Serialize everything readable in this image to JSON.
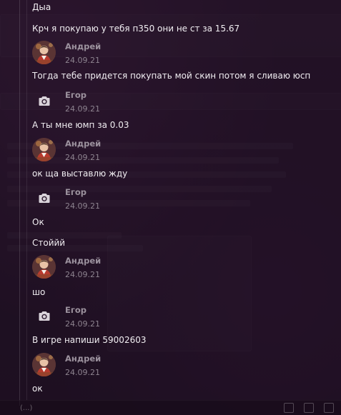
{
  "messages": [
    {
      "type": "text",
      "text": "Дыа"
    },
    {
      "type": "text",
      "text": "Крч я покупаю у тебя п350 они не ст за 15.67"
    },
    {
      "type": "header",
      "author": "Андрей",
      "date": "24.09.21",
      "avatar": "photo"
    },
    {
      "type": "text",
      "text": "Тогда тебе придется покупать мой скин потом я сливаю юсп"
    },
    {
      "type": "header",
      "author": "Егор",
      "date": "24.09.21",
      "avatar": "camera"
    },
    {
      "type": "text",
      "text": "А ты мне юмп за 0.03"
    },
    {
      "type": "header",
      "author": "Андрей",
      "date": "24.09.21",
      "avatar": "photo"
    },
    {
      "type": "text",
      "text": "ок ща выставлю жду"
    },
    {
      "type": "header",
      "author": "Егор",
      "date": "24.09.21",
      "avatar": "camera"
    },
    {
      "type": "text",
      "text": "Ок"
    },
    {
      "type": "text",
      "text": "Стоййй"
    },
    {
      "type": "header",
      "author": "Андрей",
      "date": "24.09.21",
      "avatar": "photo"
    },
    {
      "type": "text",
      "text": "шо"
    },
    {
      "type": "header",
      "author": "Егор",
      "date": "24.09.21",
      "avatar": "camera"
    },
    {
      "type": "text",
      "text": "В игре напиши 59002603"
    },
    {
      "type": "header",
      "author": "Андрей",
      "date": "24.09.21",
      "avatar": "photo"
    },
    {
      "type": "text",
      "text": "ок"
    }
  ],
  "footer": {
    "partial_text": "(...)"
  },
  "colors": {
    "background": "#261529",
    "text": "#f1eef2",
    "author": "#9c929e",
    "date": "#8d838f"
  }
}
